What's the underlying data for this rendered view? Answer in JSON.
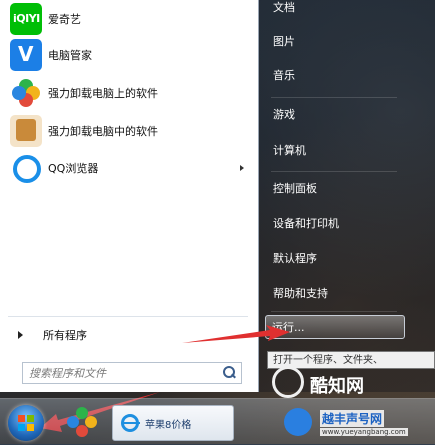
{
  "programs": [
    {
      "label": "爱奇艺",
      "icon": "iqiyi-icon",
      "icon_text": "iQIYI"
    },
    {
      "label": "电脑管家",
      "icon": "shield-v-icon",
      "icon_text": "V"
    },
    {
      "label": "强力卸载电脑上的软件",
      "icon": "clover-icon"
    },
    {
      "label": "强力卸载电脑中的软件",
      "icon": "uninstall-box-icon"
    },
    {
      "label": "QQ浏览器",
      "icon": "qq-browser-icon",
      "has_submenu": true
    }
  ],
  "all_programs_label": "所有程序",
  "search": {
    "placeholder": "搜索程序和文件"
  },
  "right_items": [
    {
      "label": "文档"
    },
    {
      "label": "图片"
    },
    {
      "label": "音乐"
    },
    {
      "label": "游戏"
    },
    {
      "label": "计算机"
    },
    {
      "label": "控制面板"
    },
    {
      "label": "设备和打印机"
    },
    {
      "label": "默认程序"
    },
    {
      "label": "帮助和支持"
    }
  ],
  "run_label": "运行...",
  "tooltip": "打开一个程序、文件夹、",
  "taskbar": {
    "ie_label": "苹果8价格"
  },
  "watermark": {
    "zhishi": "酷知网",
    "yueyang": "越丰声号网",
    "url": "www.yueyangbang.com"
  },
  "colors": {
    "accent_blue": "#1c7fe6",
    "iqiyi_green": "#00be06",
    "arrow_red": "#e03030"
  }
}
